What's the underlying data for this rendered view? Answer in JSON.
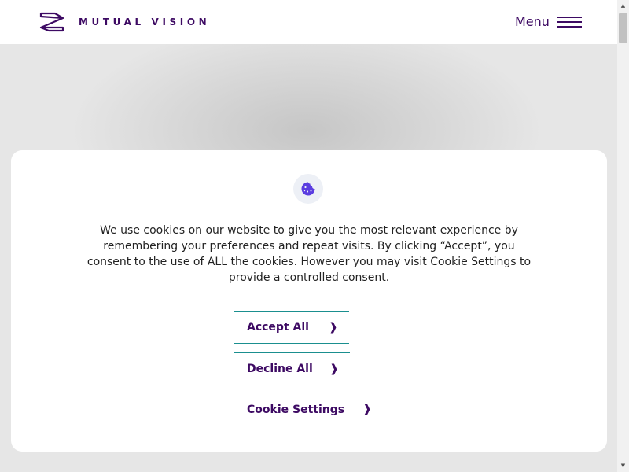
{
  "header": {
    "brand": "MUTUAL VISION",
    "menu_label": "Menu"
  },
  "icons": {
    "logo": "mutual-vision-logo-mark",
    "menu": "hamburger-icon",
    "cookie": "cookie-icon",
    "chevron": "chevron-right-icon"
  },
  "colors": {
    "brand": "#3d0a63",
    "button_border": "#1a8f8f",
    "cookie_icon": "#5b3de0",
    "overlay_background": "#d9d9d9"
  },
  "cookie_banner": {
    "message": "We use cookies on our website to give you the most relevant experience by remembering your preferences and repeat visits. By clicking “Accept”, you consent to the use of ALL the cookies. However you may visit Cookie Settings to provide a controlled consent.",
    "accept_label": "Accept All",
    "decline_label": "Decline All",
    "settings_label": "Cookie Settings",
    "chevron_glyph": "❱"
  }
}
